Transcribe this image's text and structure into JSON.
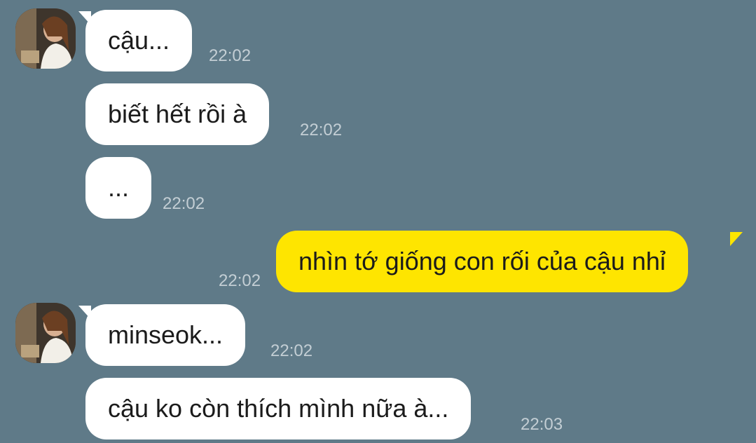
{
  "chat": {
    "messages": [
      {
        "sender": "other",
        "text": "cậu...",
        "time": "22:02"
      },
      {
        "sender": "other",
        "text": "biết hết rồi à",
        "time": "22:02"
      },
      {
        "sender": "other",
        "text": "...",
        "time": "22:02"
      },
      {
        "sender": "me",
        "text": "nhìn tớ giống con rối của cậu nhỉ",
        "time": "22:02"
      },
      {
        "sender": "other",
        "text": "minseok...",
        "time": "22:02"
      },
      {
        "sender": "other",
        "text": "cậu ko còn thích mình nữa à...",
        "time": "22:03"
      }
    ]
  },
  "colors": {
    "background": "#5f7a88",
    "incoming_bubble": "#ffffff",
    "outgoing_bubble": "#fee500",
    "timestamp": "#c3ced4"
  }
}
